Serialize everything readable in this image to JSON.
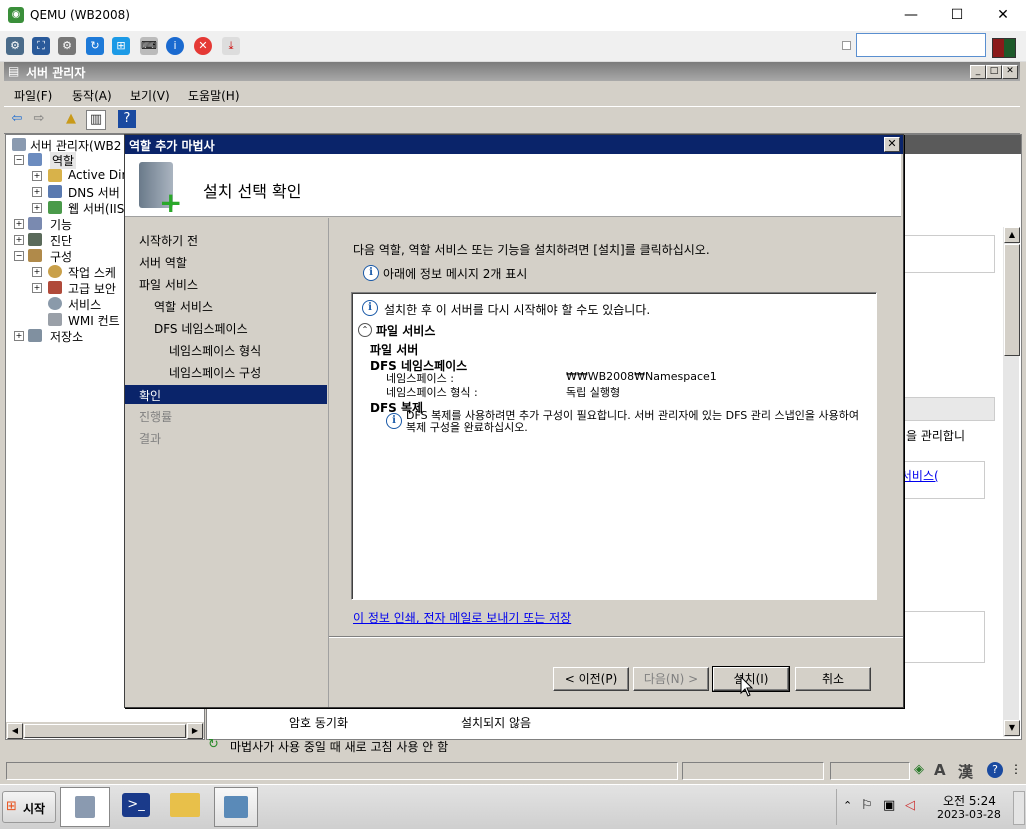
{
  "qemu": {
    "title": "QEMU (WB2008)",
    "minimize": "—",
    "maximize": "☐",
    "close": "✕"
  },
  "server_manager": {
    "title": "서버 관리자",
    "menu": [
      "파일(F)",
      "동작(A)",
      "보기(V)",
      "도움말(H)"
    ],
    "tree": {
      "root": "서버 관리자(WB2",
      "roles": "역할",
      "role_children": [
        "Active Dir",
        "DNS 서버",
        "웹 서버(IIS"
      ],
      "features": "기능",
      "diagnostics": "진단",
      "configuration": "구성",
      "config_children": [
        "작업 스케",
        "고급 보안",
        "서비스",
        "WMI 컨트"
      ],
      "storage": "저장소"
    },
    "right_pane": {
      "manage_text": "을 관리합니",
      "role_services_link": "베인 서비스(",
      "rows": [
        {
          "name": "암호 동기화",
          "status": "설치되지 않음"
        }
      ]
    },
    "status_note": "마법사가 사용 중일 때 새로 고침 사용 안 함",
    "status_icons": [
      "A",
      "漢",
      "?"
    ]
  },
  "wizard": {
    "title": "역할 추가 마법사",
    "heading": "설치 선택 확인",
    "nav_items": [
      {
        "label": "시작하기 전",
        "state": "done"
      },
      {
        "label": "서버 역할",
        "state": "done"
      },
      {
        "label": "파일 서비스",
        "state": "done"
      },
      {
        "label": "역할 서비스",
        "state": "done",
        "indent": 1
      },
      {
        "label": "DFS 네임스페이스",
        "state": "done",
        "indent": 1
      },
      {
        "label": "네임스페이스 형식",
        "state": "done",
        "indent": 2
      },
      {
        "label": "네임스페이스 구성",
        "state": "done",
        "indent": 2
      },
      {
        "label": "확인",
        "state": "active"
      },
      {
        "label": "진행률",
        "state": "disabled"
      },
      {
        "label": "결과",
        "state": "disabled"
      }
    ],
    "intro": "다음 역할, 역할 서비스 또는 기능을 설치하려면 [설치]를 클릭하십시오.",
    "info_count": "아래에 정보 메시지 2개 표시",
    "restart_note": "설치한 후 이 서버를 다시 시작해야 할 수도 있습니다.",
    "section_title": "파일 서비스",
    "file_server": "파일 서버",
    "dfs_namespace": "DFS 네임스페이스",
    "details": [
      {
        "label": "네임스페이스 :",
        "value": "₩₩WB2008₩Namespace1"
      },
      {
        "label": "네임스페이스 형식 :",
        "value": "독립 실행형"
      }
    ],
    "dfs_replication": "DFS 복제",
    "dfs_replication_note": "DFS 복제를 사용하려면 추가 구성이 필요합니다. 서버 관리자에 있는 DFS 관리 스냅인을 사용하여 복제 구성을 완료하십시오.",
    "print_link": "이 정보 인쇄, 전자 메일로 보내기 또는 저장",
    "buttons": {
      "back": "< 이전(P)",
      "next": "다음(N) >",
      "install": "설치(I)",
      "cancel": "취소"
    }
  },
  "taskbar": {
    "start": "시작",
    "time": "오전 5:24",
    "date": "2023-03-28"
  }
}
